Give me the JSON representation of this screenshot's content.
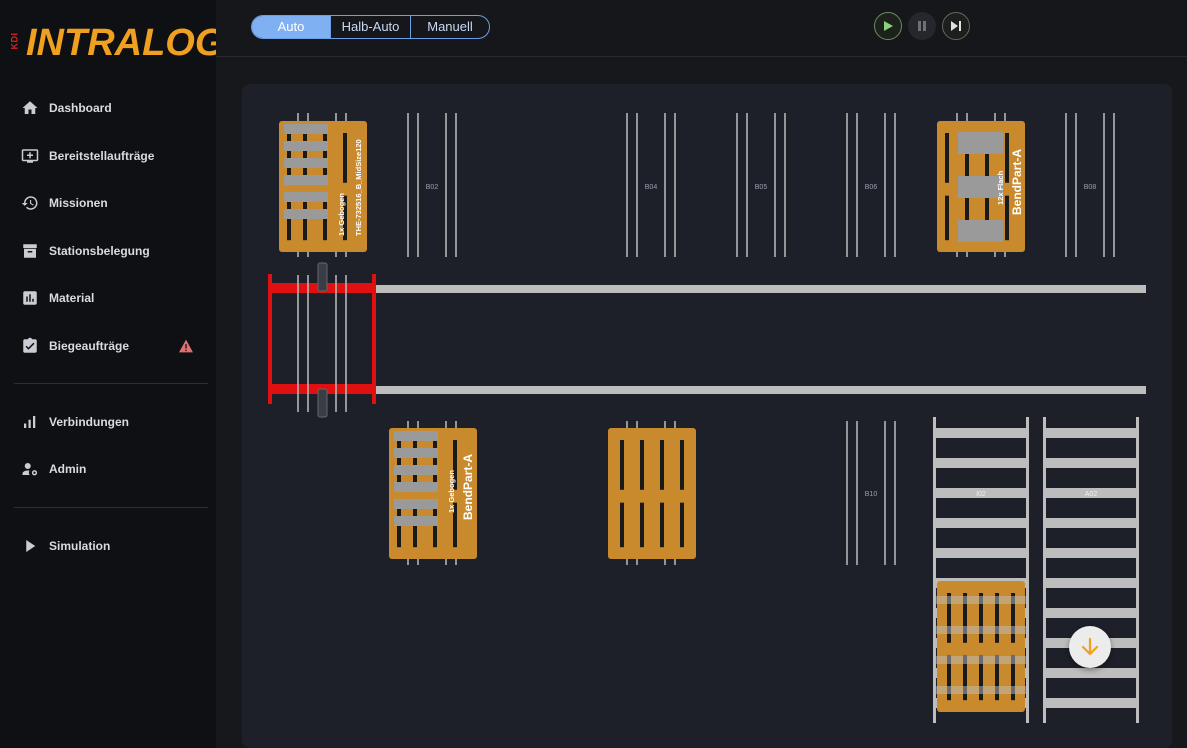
{
  "app": {
    "logo_prefix": "KDI",
    "logo_text": "INTRALOG"
  },
  "sidebar": {
    "items": [
      {
        "label": "Dashboard",
        "icon": "home-icon"
      },
      {
        "label": "Bereitstellaufträge",
        "icon": "queue-add-icon"
      },
      {
        "label": "Missionen",
        "icon": "history-icon"
      },
      {
        "label": "Stationsbelegung",
        "icon": "archive-icon"
      },
      {
        "label": "Material",
        "icon": "chart-box-icon"
      },
      {
        "label": "Biegeaufträge",
        "icon": "clipboard-check-icon",
        "warning": true
      },
      {
        "label": "Verbindungen",
        "icon": "signal-bars-icon"
      },
      {
        "label": "Admin",
        "icon": "user-gear-icon"
      },
      {
        "label": "Simulation",
        "icon": "play-triangle-icon"
      }
    ]
  },
  "mode": {
    "options": [
      "Auto",
      "Halb-Auto",
      "Manuell"
    ],
    "selected": "Auto"
  },
  "controls": {
    "play": "play-icon",
    "pause": "pause-icon",
    "skip": "skip-next-icon"
  },
  "colors": {
    "accent": "#f0a020",
    "pallet": "#c98a2e",
    "rail": "#bdbdbd",
    "shuttle": "#e01010",
    "play_green": "#8bd17c",
    "warning": "#e07070",
    "mode_blue": "#7fb0f2"
  },
  "scene": {
    "stations": {
      "B02": "B02",
      "B04": "B04",
      "B05": "B05",
      "B06": "B06",
      "B08": "B08",
      "B10": "B10",
      "I02": "I02",
      "A02": "A02"
    },
    "pallets": [
      {
        "id": "p1",
        "line1": "1x Gebogen",
        "line2": "THE-732516_B_MidSize120"
      },
      {
        "id": "p2",
        "line1": "12x Flach",
        "line2": "BendPart-A"
      },
      {
        "id": "p3",
        "line1": "1x Gebogen",
        "line2": "BendPart-A"
      }
    ]
  }
}
